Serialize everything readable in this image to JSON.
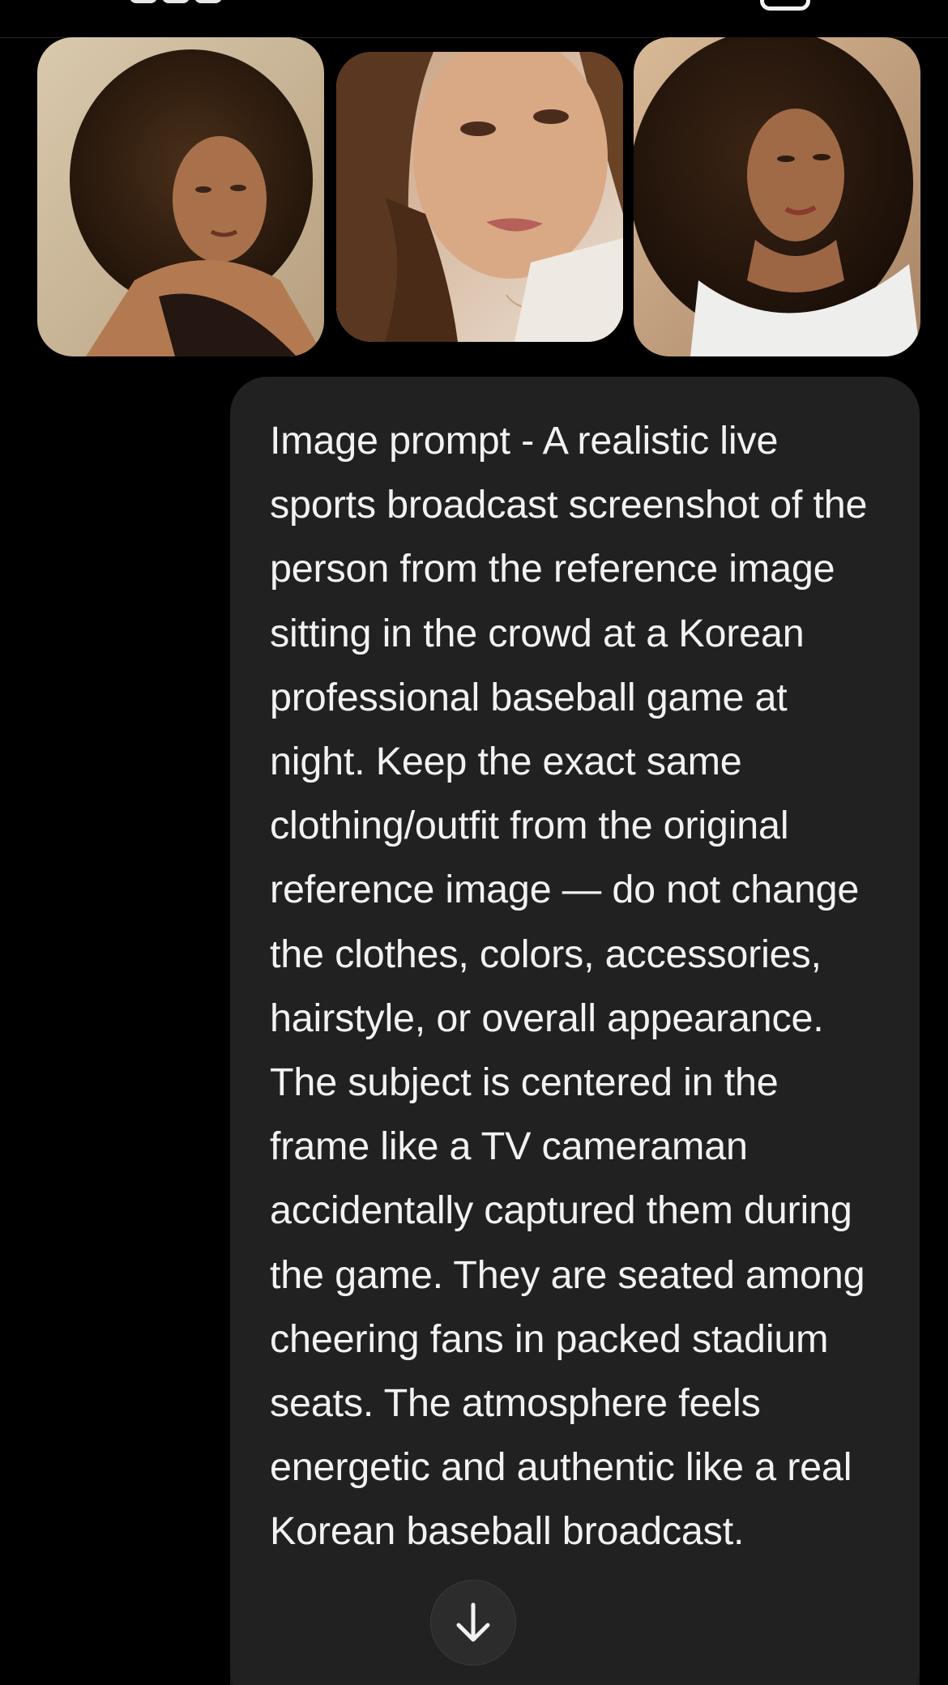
{
  "attachments": {
    "images": [
      {
        "name": "reference-photo-1"
      },
      {
        "name": "reference-photo-2"
      },
      {
        "name": "reference-photo-3"
      }
    ]
  },
  "message": {
    "paragraph_1": "Image prompt - A realistic live sports broadcast screenshot of the person from the reference image sitting in the crowd at a Korean professional baseball game at night. Keep the exact same clothing/outfit from the original reference image — do not change the clothes, colors, accessories, hairstyle, or overall appearance.",
    "paragraph_2": "The subject is centered in the frame like a TV cameraman accidentally captured them during the game. They are seated among cheering fans in packed stadium seats. The atmosphere feels energetic and authentic like a real Korean baseball broadcast."
  },
  "controls": {
    "scroll_down_icon": "arrow-down-icon"
  },
  "colors": {
    "background": "#000000",
    "bubble": "#212121",
    "text": "#f2f2f2"
  }
}
